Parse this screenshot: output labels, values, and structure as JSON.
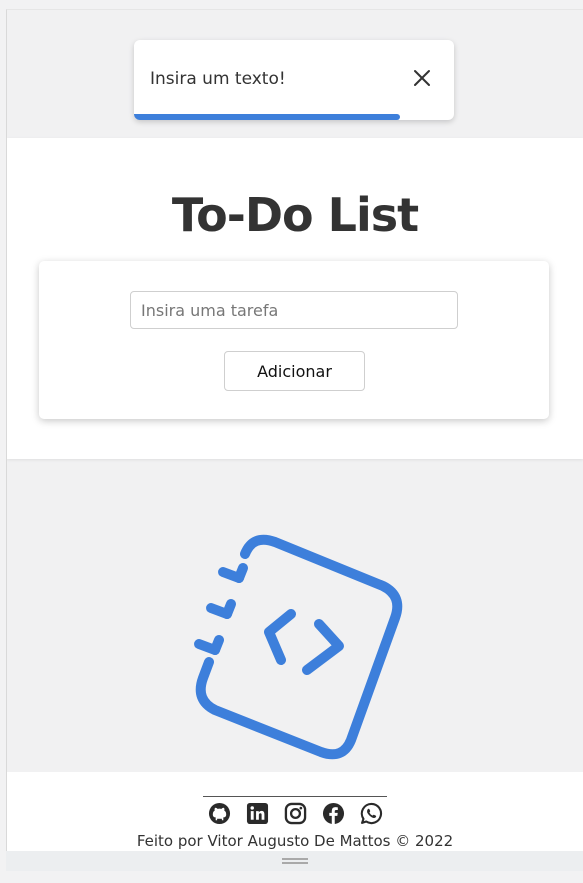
{
  "toast": {
    "message": "Insira um texto!",
    "progress": 0.83,
    "close_icon": "close-icon",
    "accent_color": "#3d7fdb"
  },
  "header": {
    "title": "To-Do List"
  },
  "form": {
    "input_placeholder": "Insira uma tarefa",
    "input_value": "",
    "add_label": "Adicionar"
  },
  "illustration": {
    "icon": "code-notebook-icon",
    "color": "#3d7fdb"
  },
  "footer": {
    "social_icons": [
      "github-icon",
      "linkedin-icon",
      "instagram-icon",
      "facebook-icon",
      "whatsapp-icon"
    ],
    "credit": "Feito por Vitor Augusto De Mattos © 2022"
  }
}
